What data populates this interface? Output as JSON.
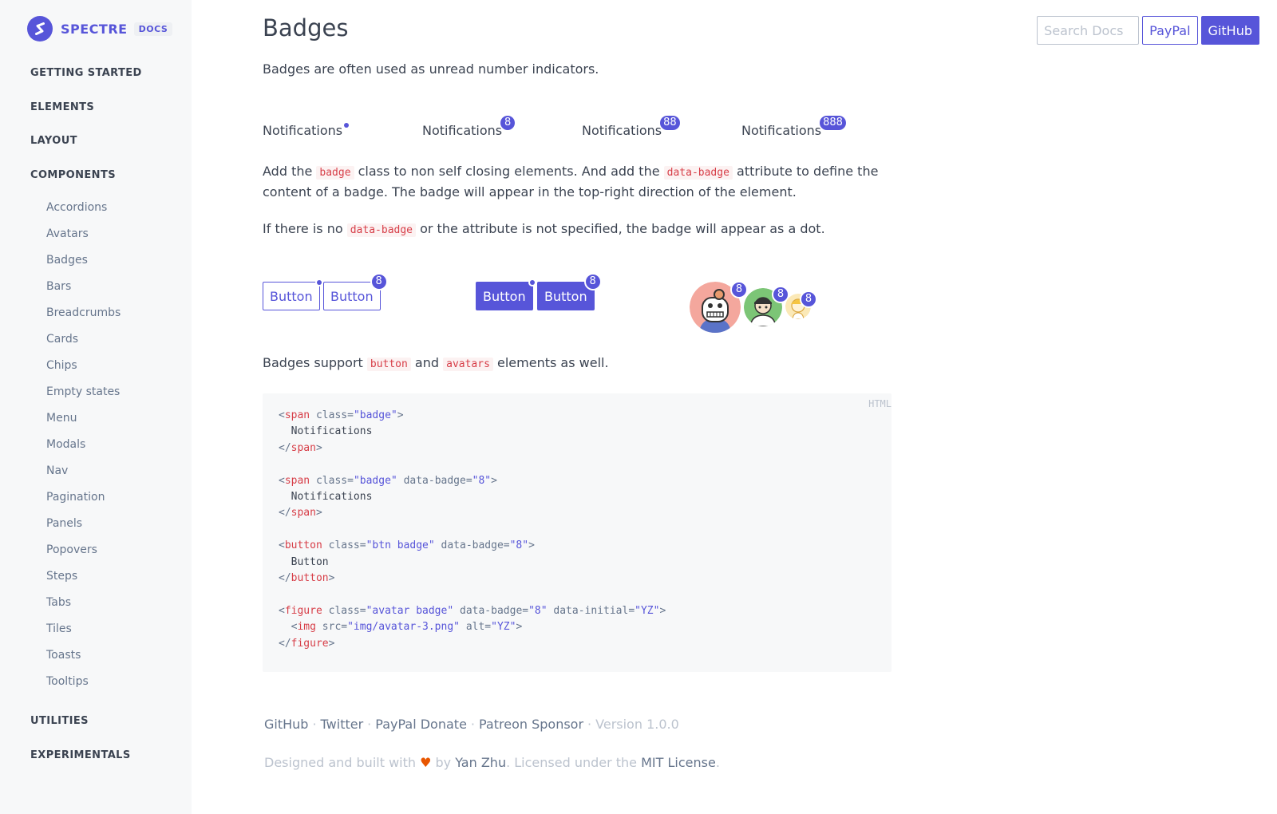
{
  "sidebar": {
    "brand": "SPECTRE",
    "brand_tag": "DOCS",
    "sections": {
      "getting_started": "GETTING STARTED",
      "elements": "ELEMENTS",
      "layout": "LAYOUT",
      "components": "COMPONENTS",
      "utilities": "UTILITIES",
      "experimentals": "EXPERIMENTALS"
    },
    "components": [
      "Accordions",
      "Avatars",
      "Badges",
      "Bars",
      "Breadcrumbs",
      "Cards",
      "Chips",
      "Empty states",
      "Menu",
      "Modals",
      "Nav",
      "Pagination",
      "Panels",
      "Popovers",
      "Steps",
      "Tabs",
      "Tiles",
      "Toasts",
      "Tooltips"
    ]
  },
  "topbar": {
    "search_placeholder": "Search Docs",
    "paypal": "PayPal",
    "github": "GitHub"
  },
  "main": {
    "title": "Badges",
    "intro": "Badges are often used as unread number indicators.",
    "notifications": [
      {
        "label": "Notifications",
        "badge": ""
      },
      {
        "label": "Notifications",
        "badge": "8"
      },
      {
        "label": "Notifications",
        "badge": "88"
      },
      {
        "label": "Notifications",
        "badge": "888"
      }
    ],
    "desc1": {
      "a": "Add the ",
      "code1": "badge",
      "b": " class to non self closing elements. And add the ",
      "code2": "data-badge",
      "c": " attribute to define the content of a badge. The badge will appear in the top-right direction of the element."
    },
    "desc2": {
      "a": "If there is no ",
      "code1": "data-badge",
      "b": " or the attribute is not specified, the badge will appear as a dot."
    },
    "buttons": [
      {
        "label": "Button",
        "badge": ""
      },
      {
        "label": "Button",
        "badge": "8"
      },
      {
        "label": "Button",
        "badge": ""
      },
      {
        "label": "Button",
        "badge": "8"
      }
    ],
    "avatar_badges": [
      "8",
      "8",
      "8"
    ],
    "desc3": {
      "a": "Badges support ",
      "code1": "button",
      "b": " and ",
      "code2": "avatars",
      "c": " elements as well."
    },
    "code_lang": "HTML"
  },
  "footer": {
    "links": [
      "GitHub",
      "Twitter",
      "PayPal Donate",
      "Patreon Sponsor"
    ],
    "sep": "·",
    "version": "Version 1.0.0",
    "line2": {
      "a": "Designed and built with ",
      "heart": "♥",
      "b": " by ",
      "author": "Yan Zhu",
      "c": ". Licensed under the ",
      "license": "MIT License",
      "d": "."
    }
  },
  "colors": {
    "accent": "#5755d9",
    "code_red": "#d73e48",
    "sidebar_bg": "#f7f8f9"
  }
}
